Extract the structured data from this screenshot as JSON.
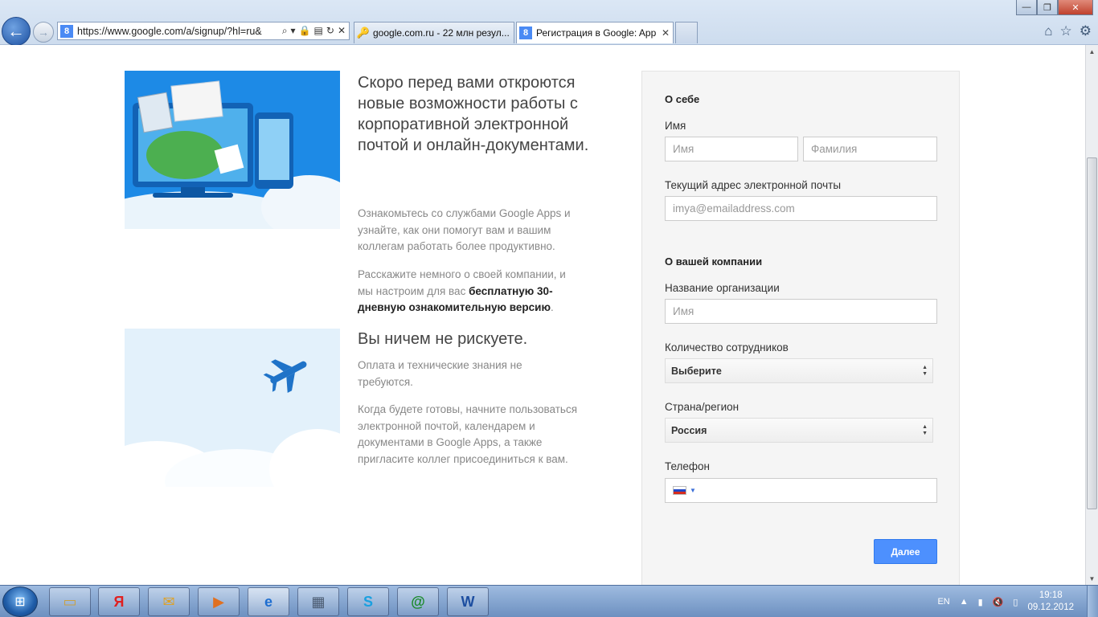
{
  "browser": {
    "address_url": "https://www.google.com/a/signup/?hl=ru&",
    "tabs": [
      {
        "title": "google.com.ru - 22 млн резул...",
        "active": false
      },
      {
        "title": "Регистрация в Google: App...",
        "active": true
      }
    ],
    "window_controls": {
      "minimize": "—",
      "maximize": "❐",
      "close": "✕"
    }
  },
  "content": {
    "heading1": "Скоро перед вами откроются новые возможности работы с корпоративной электронной почтой и онлайн-документами.",
    "para1": "Ознакомьтесь со службами Google Apps и узнайте, как они помогут вам и вашим коллегам работать более продуктивно.",
    "para2_prefix": "Расскажите немного о своей компании, и мы настроим для вас ",
    "para2_bold": "бесплатную 30-дневную ознакомительную версию",
    "para2_suffix": ".",
    "heading2": "Вы ничем не рискуете.",
    "para3": "Оплата и технические знания не требуются.",
    "para4": "Когда будете готовы, начните пользоваться электронной почтой, календарем и документами в Google Apps, а также пригласите коллег присоединиться к вам."
  },
  "form": {
    "section_about": "О себе",
    "name_label": "Имя",
    "first_name_placeholder": "Имя",
    "last_name_placeholder": "Фамилия",
    "email_label": "Текущий адрес электронной почты",
    "email_placeholder": "imya@emailaddress.com",
    "section_company": "О вашей компании",
    "org_label": "Название организации",
    "org_placeholder": "Имя",
    "employees_label": "Количество сотрудников",
    "employees_value": "Выберите",
    "country_label": "Страна/регион",
    "country_value": "Россия",
    "phone_label": "Телефон",
    "next_button": "Далее"
  },
  "taskbar": {
    "language": "EN",
    "time": "19:18",
    "date": "09.12.2012"
  }
}
